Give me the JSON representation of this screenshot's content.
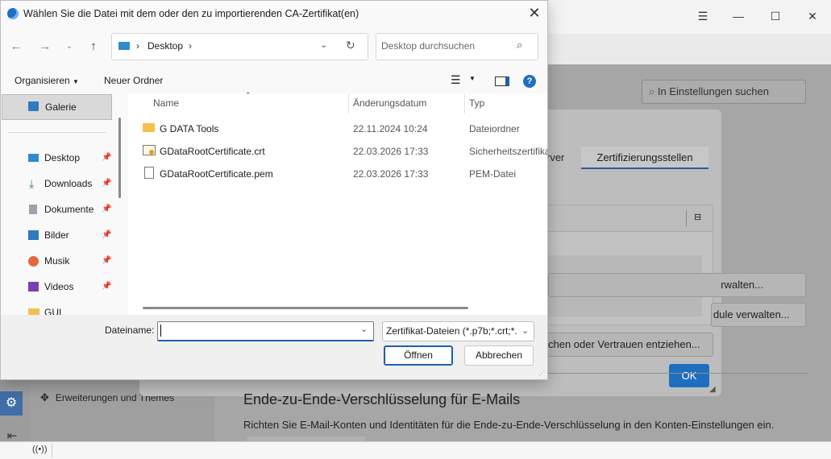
{
  "file_dialog": {
    "title": "Wählen Sie die Datei mit dem oder den zu importierenden CA-Zertifikat(en)",
    "address": {
      "location": "Desktop"
    },
    "search_placeholder": "Desktop durchsuchen",
    "commands": {
      "organize": "Organisieren",
      "new_folder": "Neuer Ordner"
    },
    "nav_pane": {
      "gallery": "Galerie",
      "items": [
        {
          "label": "Desktop",
          "icon": "desktop-icon"
        },
        {
          "label": "Downloads",
          "icon": "download-icon"
        },
        {
          "label": "Dokumente",
          "icon": "document-icon"
        },
        {
          "label": "Bilder",
          "icon": "pictures-icon"
        },
        {
          "label": "Musik",
          "icon": "music-icon"
        },
        {
          "label": "Videos",
          "icon": "video-icon"
        },
        {
          "label": "GUI",
          "icon": "folder-icon"
        }
      ]
    },
    "columns": {
      "name": "Name",
      "date": "Änderungsdatum",
      "type": "Typ"
    },
    "files": [
      {
        "name": "G DATA Tools",
        "date": "22.11.2024 10:24",
        "type": "Dateiordner",
        "icon": "folder-icon"
      },
      {
        "name": "GDataRootCertificate.crt",
        "date": "22.03.2026 17:33",
        "type": "Sicherheitszertifikat",
        "icon": "certificate-icon"
      },
      {
        "name": "GDataRootCertificate.pem",
        "date": "22.03.2026 17:33",
        "type": "PEM-Datei",
        "icon": "file-icon"
      }
    ],
    "filename_label": "Dateiname:",
    "filename_value": "",
    "filetype": "Zertifikat-Dateien (*.p7b;*.crt;*.",
    "open_button": "Öffnen",
    "cancel_button": "Abbrechen"
  },
  "background": {
    "search_settings": "In Einstellungen suchen",
    "tab_partial": "rver",
    "tab_active": "Zertifizierungsstellen",
    "btn_manage": "rwalten...",
    "btn_modules": "dule verwalten...",
    "btn_trust": "chen oder Vertrauen entziehen...",
    "ok": "OK",
    "e2e_title": "Ende-zu-Ende-Verschlüsselung für E-Mails",
    "e2e_desc": "Richten Sie E-Mail-Konten und Identitäten für die Ende-zu-Ende-Verschlüsselung in den Konten-Einstellungen ein.",
    "extensions": "Erweiterungen und Themes"
  },
  "colors": {
    "accent": "#1f6fc0",
    "help": "#1f6fc0",
    "folder": "#f2c14e"
  }
}
